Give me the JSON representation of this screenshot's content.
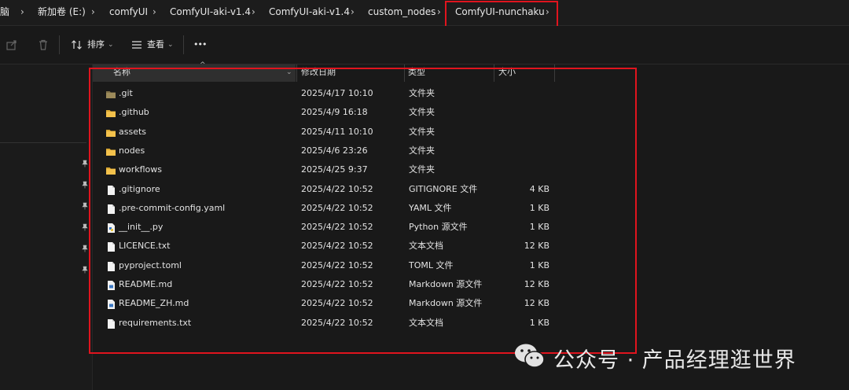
{
  "breadcrumbs": [
    "脑",
    "新加卷 (E:)",
    "comfyUI",
    "ComfyUI-aki-v1.4",
    "ComfyUI-aki-v1.4",
    "custom_nodes",
    "ComfyUI-nunchaku"
  ],
  "toolbar": {
    "sort_label": "排序",
    "view_label": "查看",
    "more_label": "•••"
  },
  "columns": {
    "name": "名称",
    "date": "修改日期",
    "type": "类型",
    "size": "大小"
  },
  "files": [
    {
      "name": ".git",
      "date": "2025/4/17 10:10",
      "type": "文件夹",
      "size": "",
      "icon": "folder-icon"
    },
    {
      "name": ".github",
      "date": "2025/4/9 16:18",
      "type": "文件夹",
      "size": "",
      "icon": "folder-icon"
    },
    {
      "name": "assets",
      "date": "2025/4/11 10:10",
      "type": "文件夹",
      "size": "",
      "icon": "folder-icon"
    },
    {
      "name": "nodes",
      "date": "2025/4/6 23:26",
      "type": "文件夹",
      "size": "",
      "icon": "folder-icon"
    },
    {
      "name": "workflows",
      "date": "2025/4/25 9:37",
      "type": "文件夹",
      "size": "",
      "icon": "folder-icon"
    },
    {
      "name": ".gitignore",
      "date": "2025/4/22 10:52",
      "type": "GITIGNORE 文件",
      "size": "4 KB",
      "icon": "file-icon"
    },
    {
      "name": ".pre-commit-config.yaml",
      "date": "2025/4/22 10:52",
      "type": "YAML 文件",
      "size": "1 KB",
      "icon": "file-icon"
    },
    {
      "name": "__init__.py",
      "date": "2025/4/22 10:52",
      "type": "Python 源文件",
      "size": "1 KB",
      "icon": "python-file-icon"
    },
    {
      "name": "LICENCE.txt",
      "date": "2025/4/22 10:52",
      "type": "文本文档",
      "size": "12 KB",
      "icon": "file-icon"
    },
    {
      "name": "pyproject.toml",
      "date": "2025/4/22 10:52",
      "type": "TOML 文件",
      "size": "1 KB",
      "icon": "file-icon"
    },
    {
      "name": "README.md",
      "date": "2025/4/22 10:52",
      "type": "Markdown 源文件",
      "size": "12 KB",
      "icon": "markdown-file-icon"
    },
    {
      "name": "README_ZH.md",
      "date": "2025/4/22 10:52",
      "type": "Markdown 源文件",
      "size": "12 KB",
      "icon": "markdown-file-icon"
    },
    {
      "name": "requirements.txt",
      "date": "2025/4/22 10:52",
      "type": "文本文档",
      "size": "1 KB",
      "icon": "file-icon"
    }
  ],
  "watermark": {
    "text": "公众号 · 产品经理逛世界"
  },
  "colors": {
    "highlight": "#e0141e",
    "folder": "#f3c14b",
    "background": "#191919"
  }
}
